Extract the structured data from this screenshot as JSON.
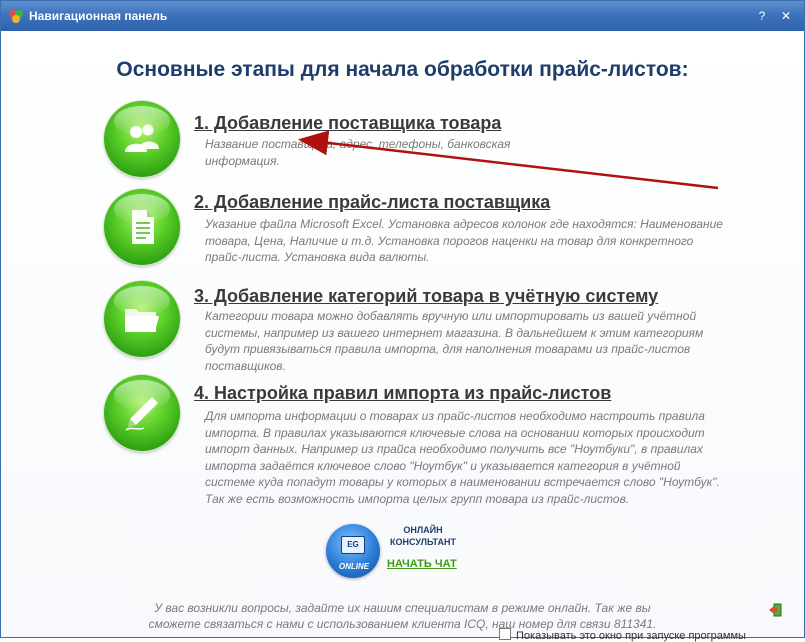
{
  "window": {
    "title": "Навигационная панель",
    "controls": {
      "help": "?",
      "close": "✕"
    }
  },
  "heading": "Основные этапы для начала обработки прайс-листов:",
  "steps": [
    {
      "title": "1. Добавление поставщика товара",
      "desc": "Название поставщика, адрес, телефоны, банковская информация.",
      "icon": "users-icon"
    },
    {
      "title": "2. Добавление прайс-листа поставщика",
      "desc": "Указание файла Microsoft Excel. Установка адресов колонок где находятся: Наименование товара, Цена, Наличие и т.д. Установка порогов наценки на товар для конкретного прайс-листа. Установка вида валюты.",
      "icon": "document-icon"
    },
    {
      "title": "3. Добавление категорий товара в учётную систему",
      "desc": "Категории товара можно добавлять вручную или импортировать из вашей учётной системы, например из вашего интернет магазина. В дальнейшем к этим категориям будут привязываться правила импорта, для наполнения товарами из прайс-листов поставщиков.",
      "icon": "folder-icon"
    },
    {
      "title": "4. Настройка правил импорта из прайс-листов",
      "desc": "Для импорта информации о товарах из прайс-листов необходимо настроить правила импорта. В правилах указываются ключевые слова на основании которых происходит импорт данных. Например из прайса необходимо получить все \"Ноутбуки\", в правилах импорта задаётся ключевое слово \"Ноутбук\" и указывается категория в учётной системе куда попадут товары у которых в наименовании встречается слово \"Ноутбук\". Так же есть возможность импорта целых групп товара из прайс-листов.",
      "icon": "pen-icon"
    }
  ],
  "chat": {
    "label_line1": "ОНЛАЙН",
    "label_line2": "КОНСУЛЬТАНТ",
    "link": "НАЧАТЬ ЧАТ",
    "badge_screen": "EG",
    "badge_online": "ONLINE"
  },
  "footer": {
    "line1": "У вас возникли вопросы, задайте их нашим специалистам в режиме онлайн. Так же вы",
    "line2": "сможете связаться с нами с использованием клиента ICQ, наш номер для связи 811341."
  },
  "startup_checkbox": {
    "label": "Показывать это окно при запуске программы",
    "checked": false
  },
  "colors": {
    "titlebar": "#3e73bd",
    "heading": "#1f3d6b",
    "accent_green": "#3e9a13",
    "arrow_red": "#b01010"
  }
}
